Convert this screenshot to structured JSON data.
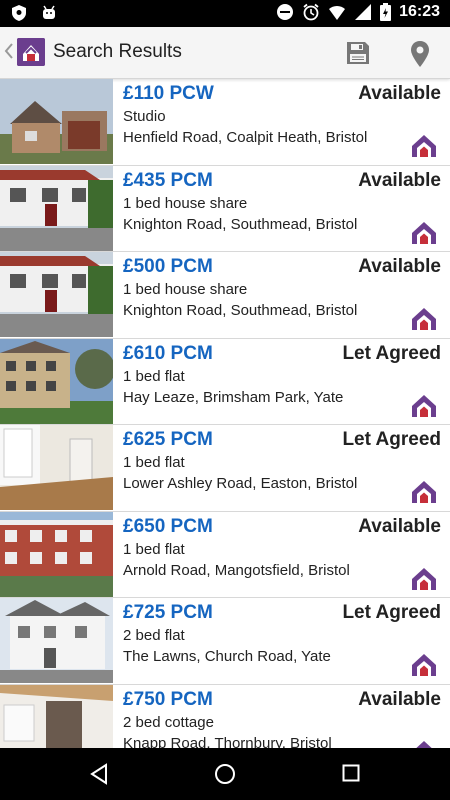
{
  "status_bar": {
    "time": "16:23",
    "left_icons": [
      "shield-icon",
      "android-icon"
    ],
    "right_icons": [
      "do-not-disturb-icon",
      "alarm-icon",
      "wifi-icon",
      "signal-icon",
      "battery-icon"
    ]
  },
  "toolbar": {
    "title": "Search Results",
    "actions": [
      "save-icon",
      "map-pin-icon"
    ]
  },
  "colors": {
    "price": "#1565c0",
    "brand_purple": "#6b3e8e",
    "brand_red": "#c62f3a"
  },
  "listings": [
    {
      "price": "£110 PCW",
      "status": "Available",
      "type": "Studio",
      "address": "Henfield Road, Coalpit Heath, Bristol"
    },
    {
      "price": "£435 PCM",
      "status": "Available",
      "type": "1 bed house share",
      "address": "Knighton Road, Southmead, Bristol"
    },
    {
      "price": "£500 PCM",
      "status": "Available",
      "type": "1 bed house share",
      "address": "Knighton Road, Southmead, Bristol"
    },
    {
      "price": "£610 PCM",
      "status": "Let Agreed",
      "type": "1 bed flat",
      "address": "Hay Leaze, Brimsham Park, Yate"
    },
    {
      "price": "£625 PCM",
      "status": "Let Agreed",
      "type": "1 bed flat",
      "address": "Lower Ashley Road, Easton, Bristol"
    },
    {
      "price": "£650 PCM",
      "status": "Available",
      "type": "1 bed flat",
      "address": "Arnold Road, Mangotsfield, Bristol"
    },
    {
      "price": "£725 PCM",
      "status": "Let Agreed",
      "type": "2 bed flat",
      "address": "The Lawns, Church Road, Yate"
    },
    {
      "price": "£750 PCM",
      "status": "Available",
      "type": "2 bed cottage",
      "address": "Knapp Road, Thornbury, Bristol"
    }
  ],
  "nav_bar": {
    "buttons": [
      "back-triangle-icon",
      "home-circle-icon",
      "recents-square-icon"
    ]
  }
}
